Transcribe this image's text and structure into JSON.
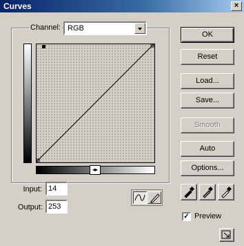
{
  "window": {
    "title": "Curves",
    "close_label": "×"
  },
  "channel": {
    "label": "Channel:",
    "value": "RGB"
  },
  "fields": {
    "input_label": "Input:",
    "input_value": "14",
    "output_label": "Output:",
    "output_value": "253"
  },
  "buttons": {
    "ok": "OK",
    "reset": "Reset",
    "load": "Load...",
    "save": "Save...",
    "smooth": "Smooth",
    "auto": "Auto",
    "options": "Options..."
  },
  "preview": {
    "label": "Preview",
    "checked": true,
    "check_glyph": "✓"
  },
  "gradient_toggle": "◂▸",
  "icons": {
    "curve_mode": "curve-icon",
    "pencil_mode": "pencil-icon",
    "eyedroppers": [
      "black-eyedropper-icon",
      "gray-eyedropper-icon",
      "white-eyedropper-icon"
    ],
    "resize": "expand-icon"
  }
}
